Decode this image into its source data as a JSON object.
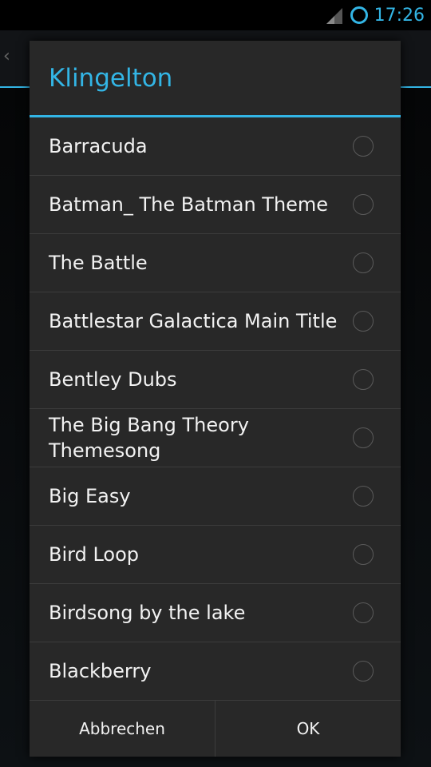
{
  "status_bar": {
    "time": "17:26"
  },
  "dialog": {
    "title": "Klingelton",
    "items": [
      {
        "label": "Barracuda"
      },
      {
        "label": "Batman_ The Batman Theme"
      },
      {
        "label": "The Battle"
      },
      {
        "label": "Battlestar Galactica Main Title"
      },
      {
        "label": "Bentley Dubs"
      },
      {
        "label": "The Big Bang Theory Themesong"
      },
      {
        "label": "Big Easy"
      },
      {
        "label": "Bird Loop"
      },
      {
        "label": "Birdsong by the lake"
      },
      {
        "label": "Blackberry"
      }
    ],
    "cancel_label": "Abbrechen",
    "ok_label": "OK"
  }
}
